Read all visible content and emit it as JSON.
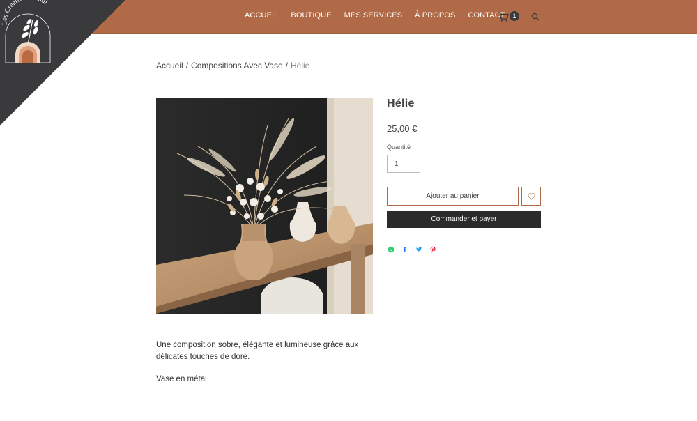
{
  "brand": {
    "name": "Les Créations d'Indi"
  },
  "nav": {
    "items": [
      {
        "label": "ACCUEIL"
      },
      {
        "label": "BOUTIQUE"
      },
      {
        "label": "MES SERVICES"
      },
      {
        "label": "À PROPOS"
      },
      {
        "label": "CONTACT"
      }
    ]
  },
  "cart": {
    "count": "1",
    "icon": "cart-icon"
  },
  "search": {
    "icon": "search-icon"
  },
  "breadcrumb": {
    "home": "Accueil",
    "sep1": "/",
    "category": "Compositions Avec Vase",
    "sep2": "/",
    "current": "Hélie"
  },
  "product": {
    "title": "Hélie",
    "price": "25,00 €",
    "quantity_label": "Quantité",
    "quantity_value": "1",
    "add_to_cart": "Ajouter au panier",
    "buy_now": "Commander et payer",
    "description": "Une composition sobre, élégante et lumineuse grâce aux délicates touches de doré.",
    "detail": "Vase en métal"
  },
  "share": [
    "whatsapp-icon",
    "facebook-icon",
    "twitter-icon",
    "pinterest-icon"
  ],
  "colors": {
    "header": "#b06a48",
    "corner": "#3a3a3c",
    "dark_button": "#2b2b2b",
    "accent_border": "#b06a48"
  }
}
